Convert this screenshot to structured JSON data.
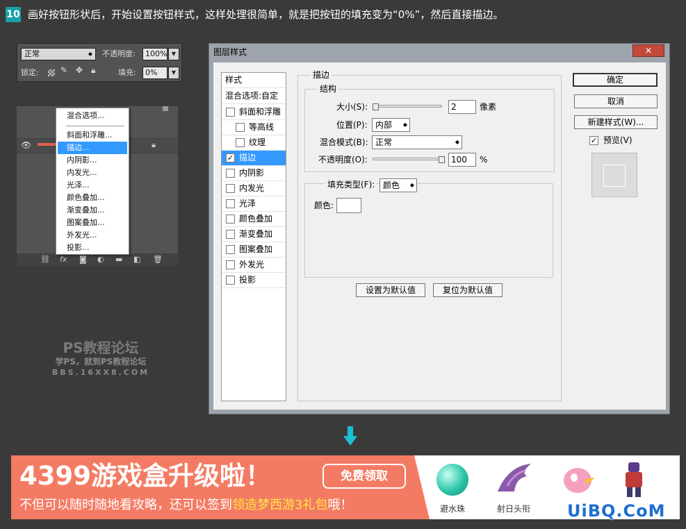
{
  "header": {
    "step_number": "10",
    "instruction": "画好按钮形状后，开始设置按钮样式，这样处理很简单，就是把按钮的填充变为“0%”，然后直接描边。"
  },
  "ps_panel": {
    "blend_mode": "正常",
    "opacity_label": "不透明度:",
    "opacity_value": "100%",
    "lock_label": "锁定:",
    "fill_label": "填充:",
    "fill_value": "0%"
  },
  "context_menu": {
    "items": [
      "混合选项...",
      "斜面和浮雕...",
      "描边...",
      "内阴影...",
      "内发光...",
      "光泽...",
      "颜色叠加...",
      "渐变叠加...",
      "图案叠加...",
      "外发光...",
      "投影..."
    ],
    "highlighted": "描边..."
  },
  "watermark": {
    "line1": "PS教程论坛",
    "line2": "学PS，就到PS教程论坛",
    "line3": "BBS.16XX8.COM"
  },
  "dialog": {
    "title": "图层样式",
    "style_list": {
      "header": "样式",
      "blend_options": "混合选项:自定",
      "items": [
        {
          "label": "斜面和浮雕",
          "checked": false
        },
        {
          "label": "等高线",
          "checked": false
        },
        {
          "label": "纹理",
          "checked": false
        },
        {
          "label": "描边",
          "checked": true
        },
        {
          "label": "内阴影",
          "checked": false
        },
        {
          "label": "内发光",
          "checked": false
        },
        {
          "label": "光泽",
          "checked": false
        },
        {
          "label": "颜色叠加",
          "checked": false
        },
        {
          "label": "渐变叠加",
          "checked": false
        },
        {
          "label": "图案叠加",
          "checked": false
        },
        {
          "label": "外发光",
          "checked": false
        },
        {
          "label": "投影",
          "checked": false
        }
      ]
    },
    "stroke": {
      "group_title": "描边",
      "structure_title": "结构",
      "size_label": "大小(S):",
      "size_value": "2",
      "size_unit": "像素",
      "size_fraction": 0.01,
      "position_label": "位置(P):",
      "position_value": "内部",
      "blend_label": "混合模式(B):",
      "blend_value": "正常",
      "opacity_label": "不透明度(O):",
      "opacity_value": "100",
      "opacity_unit": "%",
      "opacity_fraction": 1.0,
      "fill_type_label": "填充类型(F):",
      "fill_type_value": "颜色",
      "color_label": "颜色:",
      "color_value": "#ffffff",
      "set_default": "设置为默认值",
      "reset_default": "复位为默认值"
    },
    "buttons": {
      "ok": "确定",
      "cancel": "取消",
      "new_style": "新建样式(W)...",
      "preview_label": "预览(V)",
      "preview_checked": true
    }
  },
  "ad": {
    "title": "4399游戏盒升级啦！",
    "button": "免费领取",
    "subtitle_pre": "不但可以随时随地看攻略，还可以签到",
    "subtitle_highlight": "领造梦西游3礼包",
    "subtitle_post": "哦！",
    "games": [
      "避水珠",
      "射日头衔"
    ]
  },
  "site_mark": "UiBQ.CoM",
  "colors": {
    "accent": "#1aa0a8",
    "selection": "#3399ff",
    "ad_bg": "#f47b63",
    "ad_highlight": "#ffe640",
    "arrow": "#19c0d0"
  }
}
